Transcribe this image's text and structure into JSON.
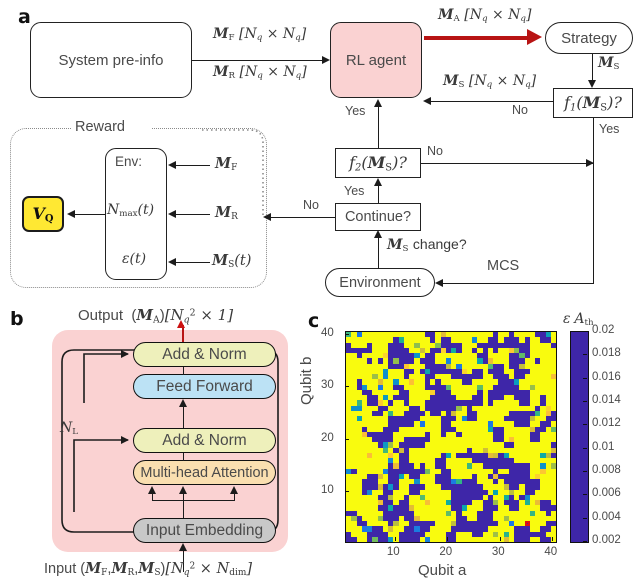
{
  "panels": {
    "a": {
      "letter": "a"
    },
    "b": {
      "letter": "b"
    },
    "c": {
      "letter": "c"
    }
  },
  "flowchart": {
    "nodes": {
      "system_preinfo": "System pre-info",
      "rl_agent": "RL agent",
      "strategy": "Strategy",
      "f1": "f₁(M_S)?",
      "f2": "f₂(M_S)?",
      "continue": "Continue?",
      "environment": "Environment",
      "reward_title": "Reward",
      "env_line1": "Env:",
      "env_line2": "N_max(t)",
      "env_line3": "ε(t)",
      "vq": "V_Q"
    },
    "edge_labels": {
      "mf_dim": "M_F [N_q × N_q]",
      "mr_dim": "M_R [N_q × N_q]",
      "ma_dim": "M_A [N_q × N_q]",
      "ms_dim": "M_S [N_q × N_q]",
      "ms": "M_S",
      "ms_change": "M_S change?",
      "mcs": "MCS",
      "mf": "M_F",
      "mr": "M_R",
      "ms_t": "M_S(t)",
      "yes1": "Yes",
      "yes2": "Yes",
      "yes3": "Yes",
      "yes4": "Yes",
      "no1": "No",
      "no2": "No",
      "no3": "No"
    },
    "colors": {
      "agent_fill": "#fad2d2",
      "vq_fill": "#ffe833",
      "action_arrow": "#b81414",
      "line": "#1c1c1c"
    }
  },
  "transformer": {
    "output_label": "Output  (M_A) [N_q² × 1]",
    "input_label": "Input (M_F, M_R, M_S) [N_q² × N_dim]",
    "layers_label": "N_L",
    "blocks": [
      {
        "label": "Add & Norm",
        "color": "#eef0bb"
      },
      {
        "label": "Feed Forward",
        "color": "#bce2f5"
      },
      {
        "label": "Add & Norm",
        "color": "#eef0bb"
      },
      {
        "label": "Multi-head Attention",
        "color": "#fadfb0"
      },
      {
        "label": "Input Embedding",
        "color": "#c8c8c8"
      }
    ],
    "bg_color": "#fad2d2",
    "output_arrow_color": "#cc1111"
  },
  "chart_data": {
    "type": "heatmap",
    "title": "",
    "xlabel": "Qubit a",
    "ylabel": "Qubit b",
    "colorbar_label": "ε  A_th",
    "xticks": [
      10,
      20,
      30,
      40
    ],
    "yticks": [
      10,
      20,
      30,
      40
    ],
    "xlim": [
      1,
      40
    ],
    "ylim": [
      1,
      40
    ],
    "nx": 40,
    "ny": 40,
    "zlim": [
      0.002,
      0.02
    ],
    "colorbar_ticks": [
      0.002,
      0.004,
      0.006,
      0.008,
      0.01,
      0.012,
      0.014,
      0.016,
      0.018,
      0.02
    ],
    "colormap": "parula",
    "highlight_cell": {
      "x": 35,
      "y": 4,
      "color": "#e01010"
    },
    "description": "Binary-dominated map: most cells at max 0.02 (yellow) or min 0.002 (dark blue), with scattered intermediate teal/green/orange values.",
    "value_seed": 20240517,
    "fraction_max": 0.56,
    "fraction_min": 0.36,
    "fraction_mid": 0.08
  }
}
